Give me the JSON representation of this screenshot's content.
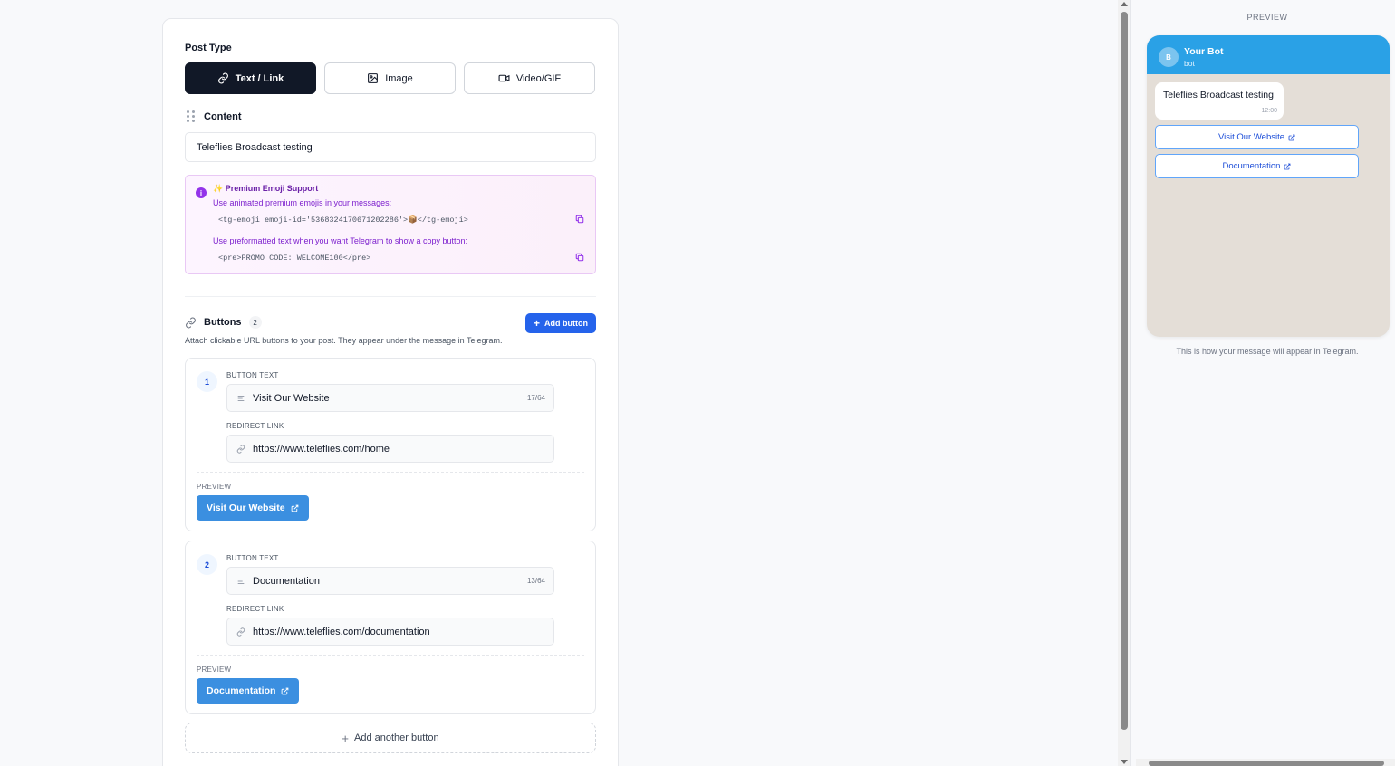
{
  "composer": {
    "post_type_label": "Post Type",
    "types": [
      {
        "label": "Text / Link",
        "icon": "link-icon",
        "active": true
      },
      {
        "label": "Image",
        "icon": "image-icon",
        "active": false
      },
      {
        "label": "Video/GIF",
        "icon": "video-icon",
        "active": false
      }
    ],
    "content_label": "Content",
    "content_value": "Teleflies Broadcast testing",
    "emoji_support": {
      "title": "✨ Premium Emoji Support",
      "line1": "Use animated premium emojis in your messages:",
      "code1": "<tg-emoji emoji-id='5368324170671202286'>📦</tg-emoji>",
      "line2": "Use preformatted text when you want Telegram to show a copy button:",
      "code2": "<pre>PROMO CODE: WELCOME100</pre>"
    },
    "buttons_section": {
      "title": "Buttons",
      "count": "2",
      "add_label": "Add button",
      "description": "Attach clickable URL buttons to your post. They appear under the message in Telegram."
    },
    "buttons": [
      {
        "number": "1",
        "text_label": "BUTTON TEXT",
        "text_value": "Visit Our Website",
        "text_count": "17/64",
        "link_label": "REDIRECT LINK",
        "link_value": "https://www.teleflies.com/home",
        "preview_label": "PREVIEW",
        "preview_text": "Visit Our Website"
      },
      {
        "number": "2",
        "text_label": "BUTTON TEXT",
        "text_value": "Documentation",
        "text_count": "13/64",
        "link_label": "REDIRECT LINK",
        "link_value": "https://www.teleflies.com/documentation",
        "preview_label": "PREVIEW",
        "preview_text": "Documentation"
      }
    ],
    "add_another_label": "Add another button"
  },
  "preview_panel": {
    "title": "PREVIEW",
    "bot_initial": "B",
    "bot_name": "Your Bot",
    "bot_sub": "bot",
    "message": "Teleflies Broadcast testing",
    "time": "12:00",
    "buttons": [
      "Visit Our Website",
      "Documentation"
    ],
    "note": "This is how your message will appear in Telegram."
  },
  "colors": {
    "primary": "#2563eb",
    "telegram_header": "#2aa1e6",
    "telegram_bg": "#e4ded7",
    "active_type": "#111827"
  }
}
